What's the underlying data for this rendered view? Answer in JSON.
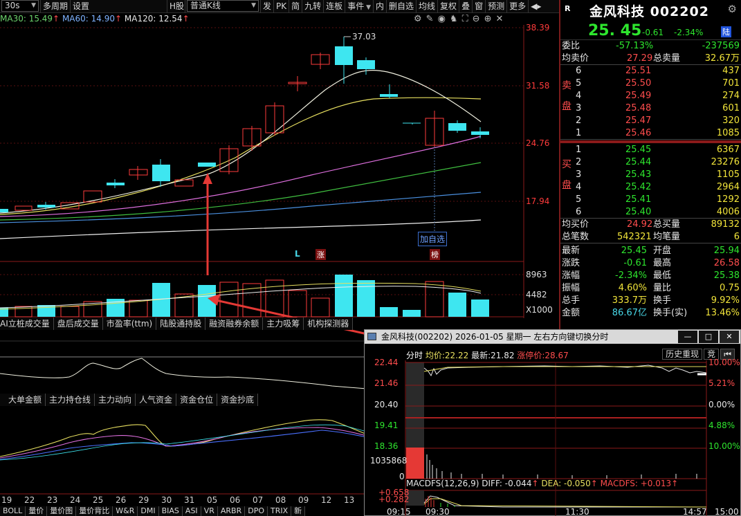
{
  "toolbar": {
    "period": "30s",
    "multi_period": "多周期",
    "settings": "设置",
    "h_share": "H股",
    "kline_type": "普通K线",
    "items": [
      "发",
      "PK",
      "简",
      "九转",
      "连板",
      "事件",
      "内",
      "删自选",
      "均线",
      "复权",
      "叠",
      "窗",
      "预测",
      "更多"
    ]
  },
  "ma_legend": {
    "ma30": "MA30: 15.49",
    "ma60": "MA60: 14.90",
    "ma120": "MA120: 12.54"
  },
  "kline": {
    "high_marker": "37.03",
    "price_axis": [
      "38.39",
      "31.58",
      "24.76",
      "17.94"
    ],
    "volume_axis": [
      "8963",
      "4482",
      "X1000"
    ],
    "markers": {
      "L": "L",
      "zhang": "涨",
      "bang": "榜"
    },
    "add_watch": "加自选",
    "colors": {
      "up": "#ff3b3b",
      "down": "#3ee6f0",
      "ma_white": "#f0f0e0",
      "ma_yellow": "#e8e060",
      "ma_pink": "#e070e0",
      "ma_green": "#40c040",
      "ma_blue": "#4a90e0"
    }
  },
  "tabs_row1": [
    "AI立桩成交量",
    "盘后成交量",
    "市盈率(ttm)",
    "陆股通持股",
    "融资融券余额",
    "主力吸筹",
    "机构探测器"
  ],
  "tabs_row2": [
    "大单金额",
    "主力持仓线",
    "主力动向",
    "人气资金",
    "资金仓位",
    "资金抄底"
  ],
  "dates": [
    "19",
    "22",
    "23",
    "24",
    "25",
    "26",
    "29",
    "30",
    "31",
    "05",
    "06",
    "07",
    "08",
    "09",
    "12",
    "13"
  ],
  "indicator_tabs": [
    "BOLL",
    "量价",
    "量价图",
    "量价背比",
    "W&R",
    "DMI",
    "BIAS",
    "ASI",
    "VR",
    "ARBR",
    "DPO",
    "TRIX",
    "新"
  ],
  "stock": {
    "r": "R",
    "name": "金风科技 002202",
    "price": "25. 45",
    "change": "-0.61",
    "change_pct": "-2.34%",
    "lu": "陆"
  },
  "weibi": {
    "label": "委比",
    "pct": "-57.13%",
    "value": "-237569"
  },
  "ask_avg": {
    "label": "均卖价",
    "price": "27.29",
    "total_label": "总卖量",
    "total": "32.67万"
  },
  "sell_side_label": [
    "卖",
    "盘"
  ],
  "asks": [
    {
      "level": "6",
      "price": "25.51",
      "vol": "437"
    },
    {
      "level": "5",
      "price": "25.50",
      "vol": "701"
    },
    {
      "level": "4",
      "price": "25.49",
      "vol": "274"
    },
    {
      "level": "3",
      "price": "25.48",
      "vol": "601"
    },
    {
      "level": "2",
      "price": "25.47",
      "vol": "320"
    },
    {
      "level": "1",
      "price": "25.46",
      "vol": "1085"
    }
  ],
  "buy_side_label": [
    "买",
    "盘"
  ],
  "bids": [
    {
      "level": "1",
      "price": "25.45",
      "vol": "6367"
    },
    {
      "level": "2",
      "price": "25.44",
      "vol": "23276"
    },
    {
      "level": "3",
      "price": "25.43",
      "vol": "1105"
    },
    {
      "level": "4",
      "price": "25.42",
      "vol": "2964"
    },
    {
      "level": "5",
      "price": "25.41",
      "vol": "1292"
    },
    {
      "level": "6",
      "price": "25.40",
      "vol": "4006"
    }
  ],
  "bid_avg": {
    "label": "均买价",
    "price": "24.92",
    "total_label": "总买量",
    "total": "89132"
  },
  "total_orders": {
    "label": "总笔数",
    "value": "542321",
    "avg_label": "均笔量",
    "avg": "6"
  },
  "stats": [
    {
      "l1": "最新",
      "v1": "25.45",
      "l2": "开盘",
      "v2": "25.94",
      "c1": "green",
      "c2": "green"
    },
    {
      "l1": "涨跌",
      "v1": "-0.61",
      "l2": "最高",
      "v2": "26.58",
      "c1": "green",
      "c2": "red"
    },
    {
      "l1": "涨幅",
      "v1": "-2.34%",
      "l2": "最低",
      "v2": "25.38",
      "c1": "green",
      "c2": "green"
    },
    {
      "l1": "振幅",
      "v1": "4.60%",
      "l2": "量比",
      "v2": "0.75",
      "c1": "white",
      "c2": "white"
    },
    {
      "l1": "总手",
      "v1": "333.7万",
      "l2": "换手",
      "v2": "9.92%",
      "c1": "white",
      "c2": "white"
    },
    {
      "l1": "金额",
      "v1": "86.67亿",
      "l2": "换手(实)",
      "v2": "13.46%",
      "c1": "white",
      "c2": "white"
    }
  ],
  "popup": {
    "title": "金风科技(002202) 2026-01-05 星期一    左右方向键切换分时",
    "btn_min": "—",
    "btn_max": "□",
    "btn_close": "✕",
    "info_label": "分时",
    "avg_label": "均价:",
    "avg_value": "22.22",
    "last_label": "最新:",
    "last_value": "21.82",
    "limit_label": "涨停价:",
    "limit_value": "28.67",
    "history": "历史重现",
    "history_btn2": "竞",
    "left_axis": [
      "22.44",
      "21.46",
      "20.40",
      "19.41",
      "18.36",
      "1035868",
      "0"
    ],
    "right_axis": [
      "10.00%",
      "5.21%",
      "0.00%",
      "4.88%",
      "10.00%"
    ],
    "macd_label": "MACDFS(12,26,9) DIFF: -0.044",
    "dea_label": "DEA: -0.050",
    "macd_value": "MACDFS: +0.013",
    "macd_axis": [
      "+0.658",
      "+0.282"
    ],
    "time_axis": [
      "09:15",
      "09:30",
      "11:30",
      "14:57",
      "15:00"
    ]
  }
}
